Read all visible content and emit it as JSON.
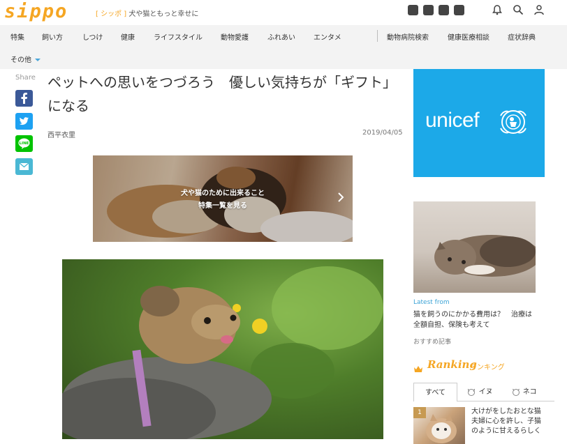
{
  "header": {
    "logo_text": "sippo",
    "tagline_open": "[ シッポ ]",
    "tagline_text": " 犬や猫ともっと幸せに",
    "social_icons": [
      "facebook-icon",
      "twitter-icon",
      "instagram-icon",
      "youtube-icon"
    ],
    "utility_icons": [
      "notification-bell-icon",
      "search-icon",
      "user-icon"
    ]
  },
  "nav": {
    "items": [
      "特集",
      "飼い方",
      "しつけ",
      "健康",
      "ライフスタイル",
      "動物愛護",
      "ふれあい",
      "エンタメ"
    ],
    "right_items": [
      "動物病院検索",
      "健康医療相談",
      "症状辞典"
    ],
    "more_label": "その他"
  },
  "share": {
    "label": "Share",
    "buttons": [
      "facebook-share-icon",
      "twitter-share-icon",
      "line-share-icon",
      "mail-share-icon"
    ]
  },
  "article": {
    "title": "ペットへの思いをつづろう　優しい気持ちが「ギフト」になる",
    "author": "西平衣里",
    "date": "2019/04/05"
  },
  "banner": {
    "line1": "犬や猫のために出来ること",
    "line2": "特集一覧を見る"
  },
  "sidebar": {
    "ad_text": "unicef",
    "latest_from": "Latest from",
    "latest_title": "猫を飼うのにかかる費用は？　治療は全額自担、保険も考えて",
    "recommend_label": "おすすめ記事",
    "ranking_logo": "Ranking",
    "ranking_jp": "ランキング",
    "tabs": [
      "すべて",
      "イヌ",
      "ネコ"
    ],
    "rank_item": {
      "number": "1",
      "title": "大けがをしたおとな猫　夫婦に心を許し、子猫のように甘えるらしく"
    }
  },
  "colors": {
    "brand": "#f5a623",
    "nav_bg": "#f3f3f3",
    "unicef_blue": "#1ca9e8",
    "facebook": "#3b5998",
    "twitter": "#1da1f2",
    "line": "#00c300",
    "mail": "#4ab8d4",
    "link_blue": "#3ba3d6"
  }
}
